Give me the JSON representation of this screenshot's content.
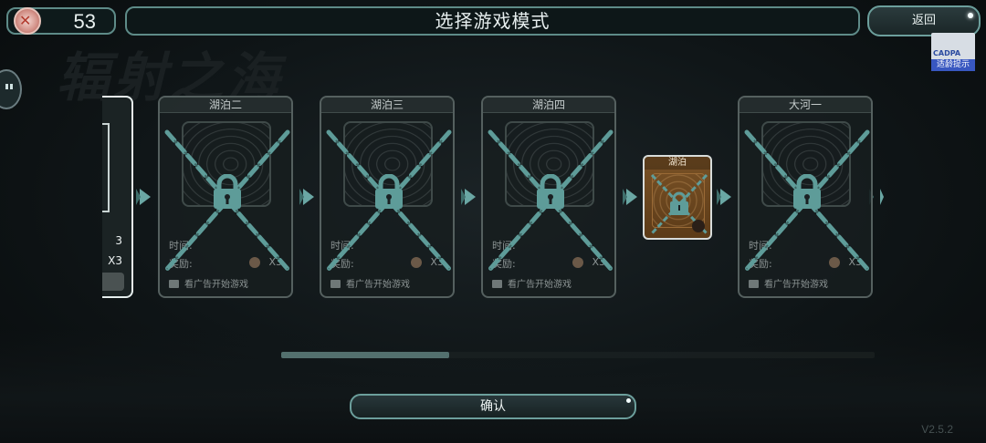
{
  "header": {
    "coins": "53",
    "title": "选择游戏模式",
    "back_label": "返回",
    "rating_badge": {
      "top": "CADPA",
      "bottom": "适龄提示"
    }
  },
  "background": {
    "logo_text": "辐射之海"
  },
  "cards": [
    {
      "name": "湖泊二",
      "time_label": "时间:",
      "reward_label": "奖励:",
      "reward_mult": "X3",
      "ad_text": "看广告开始游戏",
      "locked": true
    },
    {
      "name": "湖泊三",
      "time_label": "时间:",
      "reward_label": "奖励:",
      "reward_mult": "X3",
      "ad_text": "看广告开始游戏",
      "locked": true
    },
    {
      "name": "湖泊四",
      "time_label": "时间:",
      "reward_label": "奖励:",
      "reward_mult": "X3",
      "ad_text": "看广告开始游戏",
      "locked": true
    },
    {
      "name": "大河一",
      "time_label": "时间:",
      "reward_label": "奖励:",
      "reward_mult": "X3",
      "ad_text": "看广告开始游戏",
      "locked": true
    }
  ],
  "left_card": {
    "value1": "3",
    "value2": "X3"
  },
  "small_card": {
    "name": "湖泊"
  },
  "scroll": {
    "position": 0.0,
    "thumb_fraction": 0.28
  },
  "confirm_label": "确认",
  "version": "V2.5.2",
  "colors": {
    "accent": "#6aa7a4",
    "chain": "#5e9c99",
    "card_bg": "#171e1f",
    "small_card_bg": "#6b4520"
  }
}
